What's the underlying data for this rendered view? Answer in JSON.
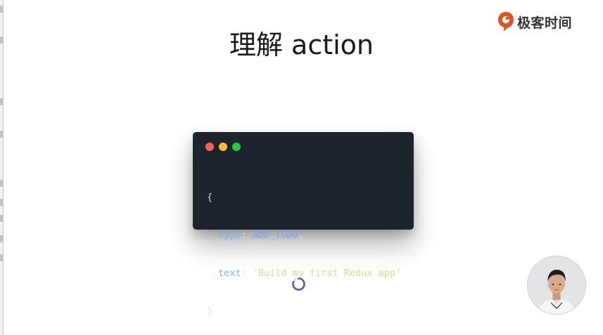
{
  "brand": {
    "name": "极客时间",
    "accent": "#e0531f",
    "icon": "geektime-logo-icon"
  },
  "slide": {
    "title": "理解 action"
  },
  "code_card": {
    "window_dots": [
      "#ff5f57",
      "#febc2e",
      "#28c840"
    ],
    "code_lines": {
      "open_brace": "{",
      "type_key": "type",
      "type_colon": ": ",
      "type_value": "ADD_TODO",
      "type_comma": ",",
      "text_key": "text",
      "text_colon": ": ",
      "text_value": "'Build my first Redux app'",
      "close_brace": "}"
    },
    "colors": {
      "background": "#1b262c",
      "key": "#6cb6ff",
      "constant": "#7aa2ff",
      "string": "#c3e88d"
    }
  },
  "loading": {
    "icon": "loading-spinner-icon"
  },
  "presenter": {
    "icon": "presenter-video-avatar"
  }
}
